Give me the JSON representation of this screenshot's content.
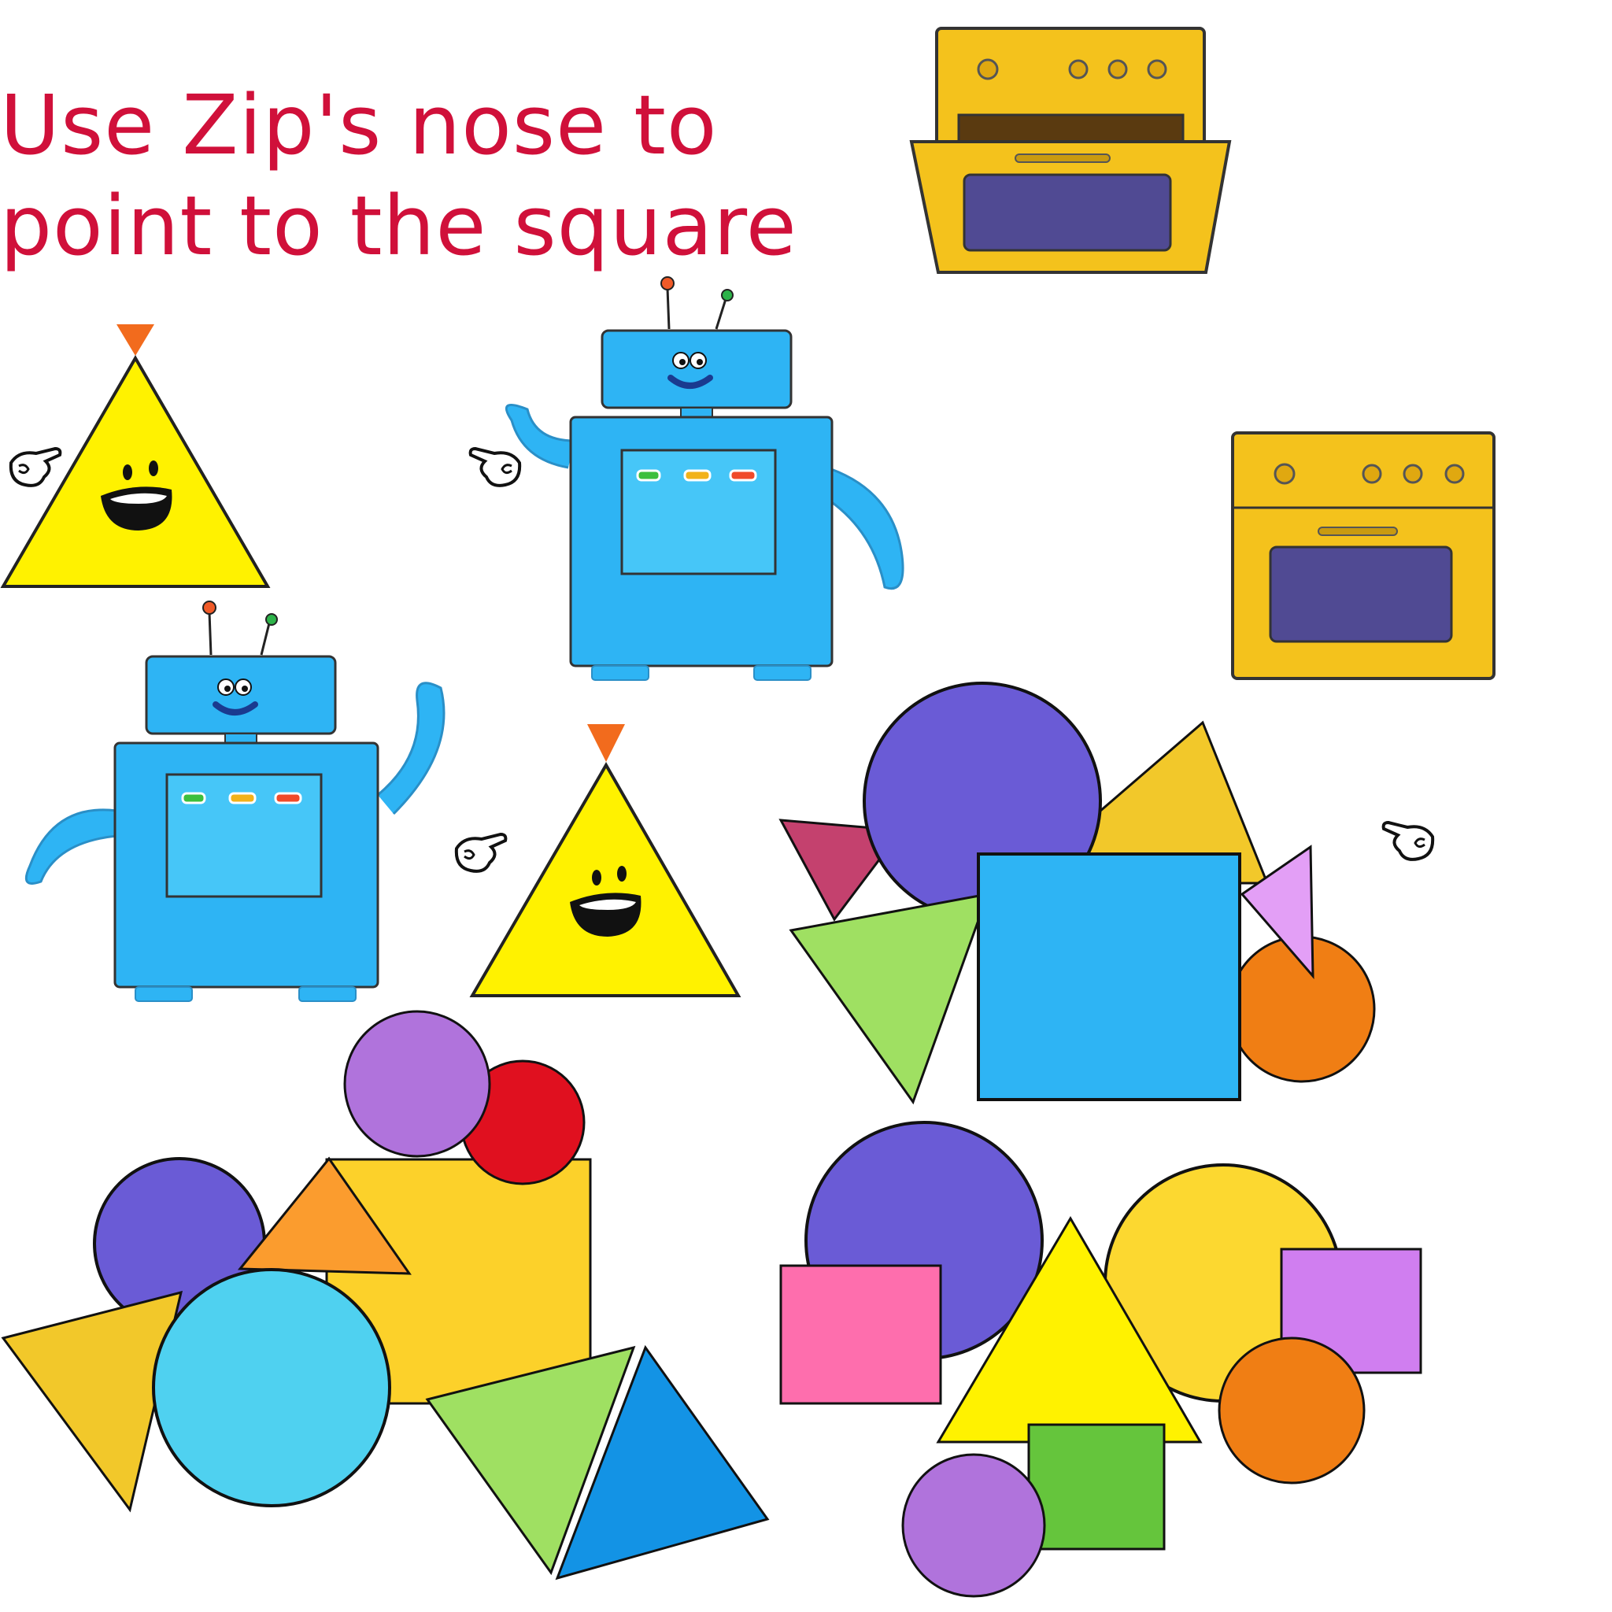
{
  "instruction": {
    "text": "Use Zip's nose to point to the square"
  },
  "scene": {
    "characters": [
      {
        "name": "zip-triangle",
        "count": 2,
        "color": "#fff200",
        "nose_color": "#f26b1d"
      },
      {
        "name": "robot",
        "count": 2,
        "color": "#2eb4f4"
      }
    ],
    "ovens": [
      {
        "state": "open",
        "color": "#f2c118",
        "window_color": "#504a93"
      },
      {
        "state": "closed",
        "color": "#f2c118",
        "window_color": "#504a93"
      }
    ],
    "shape_piles": 3
  },
  "colors": {
    "instruction": "#d0103a",
    "blue_square": "#2eb4f4",
    "purple": "#6a5bd6",
    "outline": "#111111"
  }
}
